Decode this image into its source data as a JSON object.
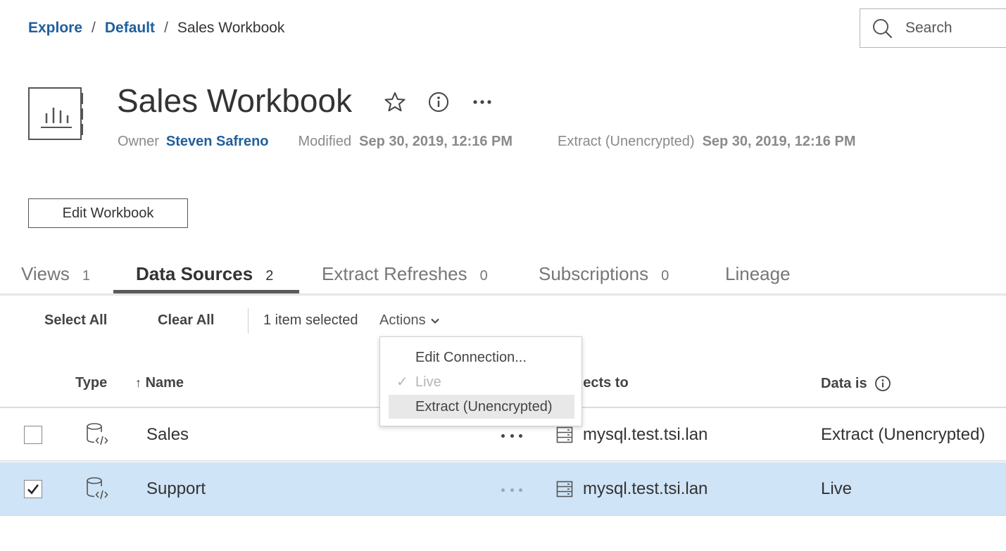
{
  "breadcrumb": {
    "items": [
      "Explore",
      "Default",
      "Sales Workbook"
    ],
    "separator": "/"
  },
  "search": {
    "placeholder": "Search"
  },
  "workbook": {
    "title": "Sales Workbook",
    "owner_label": "Owner",
    "owner_name": "Steven Safreno",
    "modified_label": "Modified",
    "modified_value": "Sep 30, 2019, 12:16 PM",
    "extract_label": "Extract (Unencrypted)",
    "extract_value": "Sep 30, 2019, 12:16 PM",
    "edit_button": "Edit Workbook"
  },
  "tabs": [
    {
      "label": "Views",
      "count": "1",
      "active": false
    },
    {
      "label": "Data Sources",
      "count": "2",
      "active": true
    },
    {
      "label": "Extract Refreshes",
      "count": "0",
      "active": false
    },
    {
      "label": "Subscriptions",
      "count": "0",
      "active": false
    },
    {
      "label": "Lineage",
      "count": "",
      "active": false
    }
  ],
  "toolbar": {
    "select_all": "Select All",
    "clear_all": "Clear All",
    "selected_text": "1 item selected",
    "actions": "Actions"
  },
  "actions_menu": {
    "items": [
      "Edit Connection...",
      "Live",
      "Extract (Unencrypted)"
    ],
    "checkmark": "✓"
  },
  "table": {
    "columns": {
      "type": "Type",
      "sort_arrow": "↑",
      "name": "Name",
      "connects_to": "nects to",
      "data_is": "Data is"
    },
    "rows": [
      {
        "name": "Sales",
        "connects_to": "mysql.test.tsi.lan",
        "data_is": "Extract (Unencrypted)",
        "selected": false
      },
      {
        "name": "Support",
        "connects_to": "mysql.test.tsi.lan",
        "data_is": "Live",
        "selected": true
      }
    ]
  },
  "colors": {
    "link": "#1f5f9b",
    "selected_row": "#cfe4f6",
    "menu_highlight": "#e8e8e8"
  },
  "icons": [
    "search-icon",
    "workbook-icon",
    "star-icon",
    "info-icon",
    "more-icon",
    "chevron-down-icon",
    "data-source-icon",
    "server-icon",
    "checkmark-icon"
  ]
}
